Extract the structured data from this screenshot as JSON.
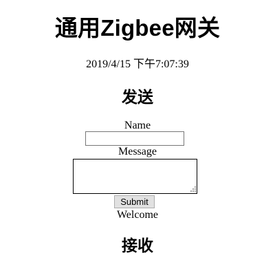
{
  "header": {
    "title": "通用Zigbee网关",
    "datetime": "2019/4/15 下午7:07:39"
  },
  "send_section": {
    "heading": "发送",
    "name_label": "Name",
    "name_value": "",
    "message_label": "Message",
    "message_value": "",
    "submit_label": "Submit",
    "welcome_text": "Welcome"
  },
  "receive_section": {
    "heading": "接收"
  }
}
